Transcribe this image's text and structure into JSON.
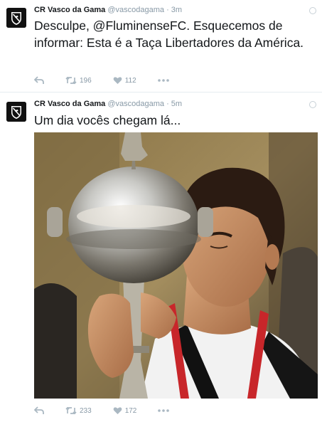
{
  "tweets": [
    {
      "name": "CR Vasco da Gama",
      "handle": "@vascodagama",
      "separator": "·",
      "time": "3m",
      "text": "Desculpe, @FluminenseFC. Esquecemos de informar: Esta é a Taça Libertadores da América.",
      "retweets": "196",
      "likes": "112"
    },
    {
      "name": "CR Vasco da Gama",
      "handle": "@vascodagama",
      "separator": "·",
      "time": "5m",
      "text": "Um dia vocês chegam lá...",
      "retweets": "233",
      "likes": "172"
    }
  ],
  "icons": {
    "reply": "reply-icon",
    "retweet": "retweet-icon",
    "like": "heart-icon",
    "more": "more-icon",
    "avatar": "vasco-crest-icon",
    "caret": "caret-icon"
  },
  "colors": {
    "text": "#14171a",
    "muted": "#8899a6",
    "divider": "#e6ecf0"
  }
}
